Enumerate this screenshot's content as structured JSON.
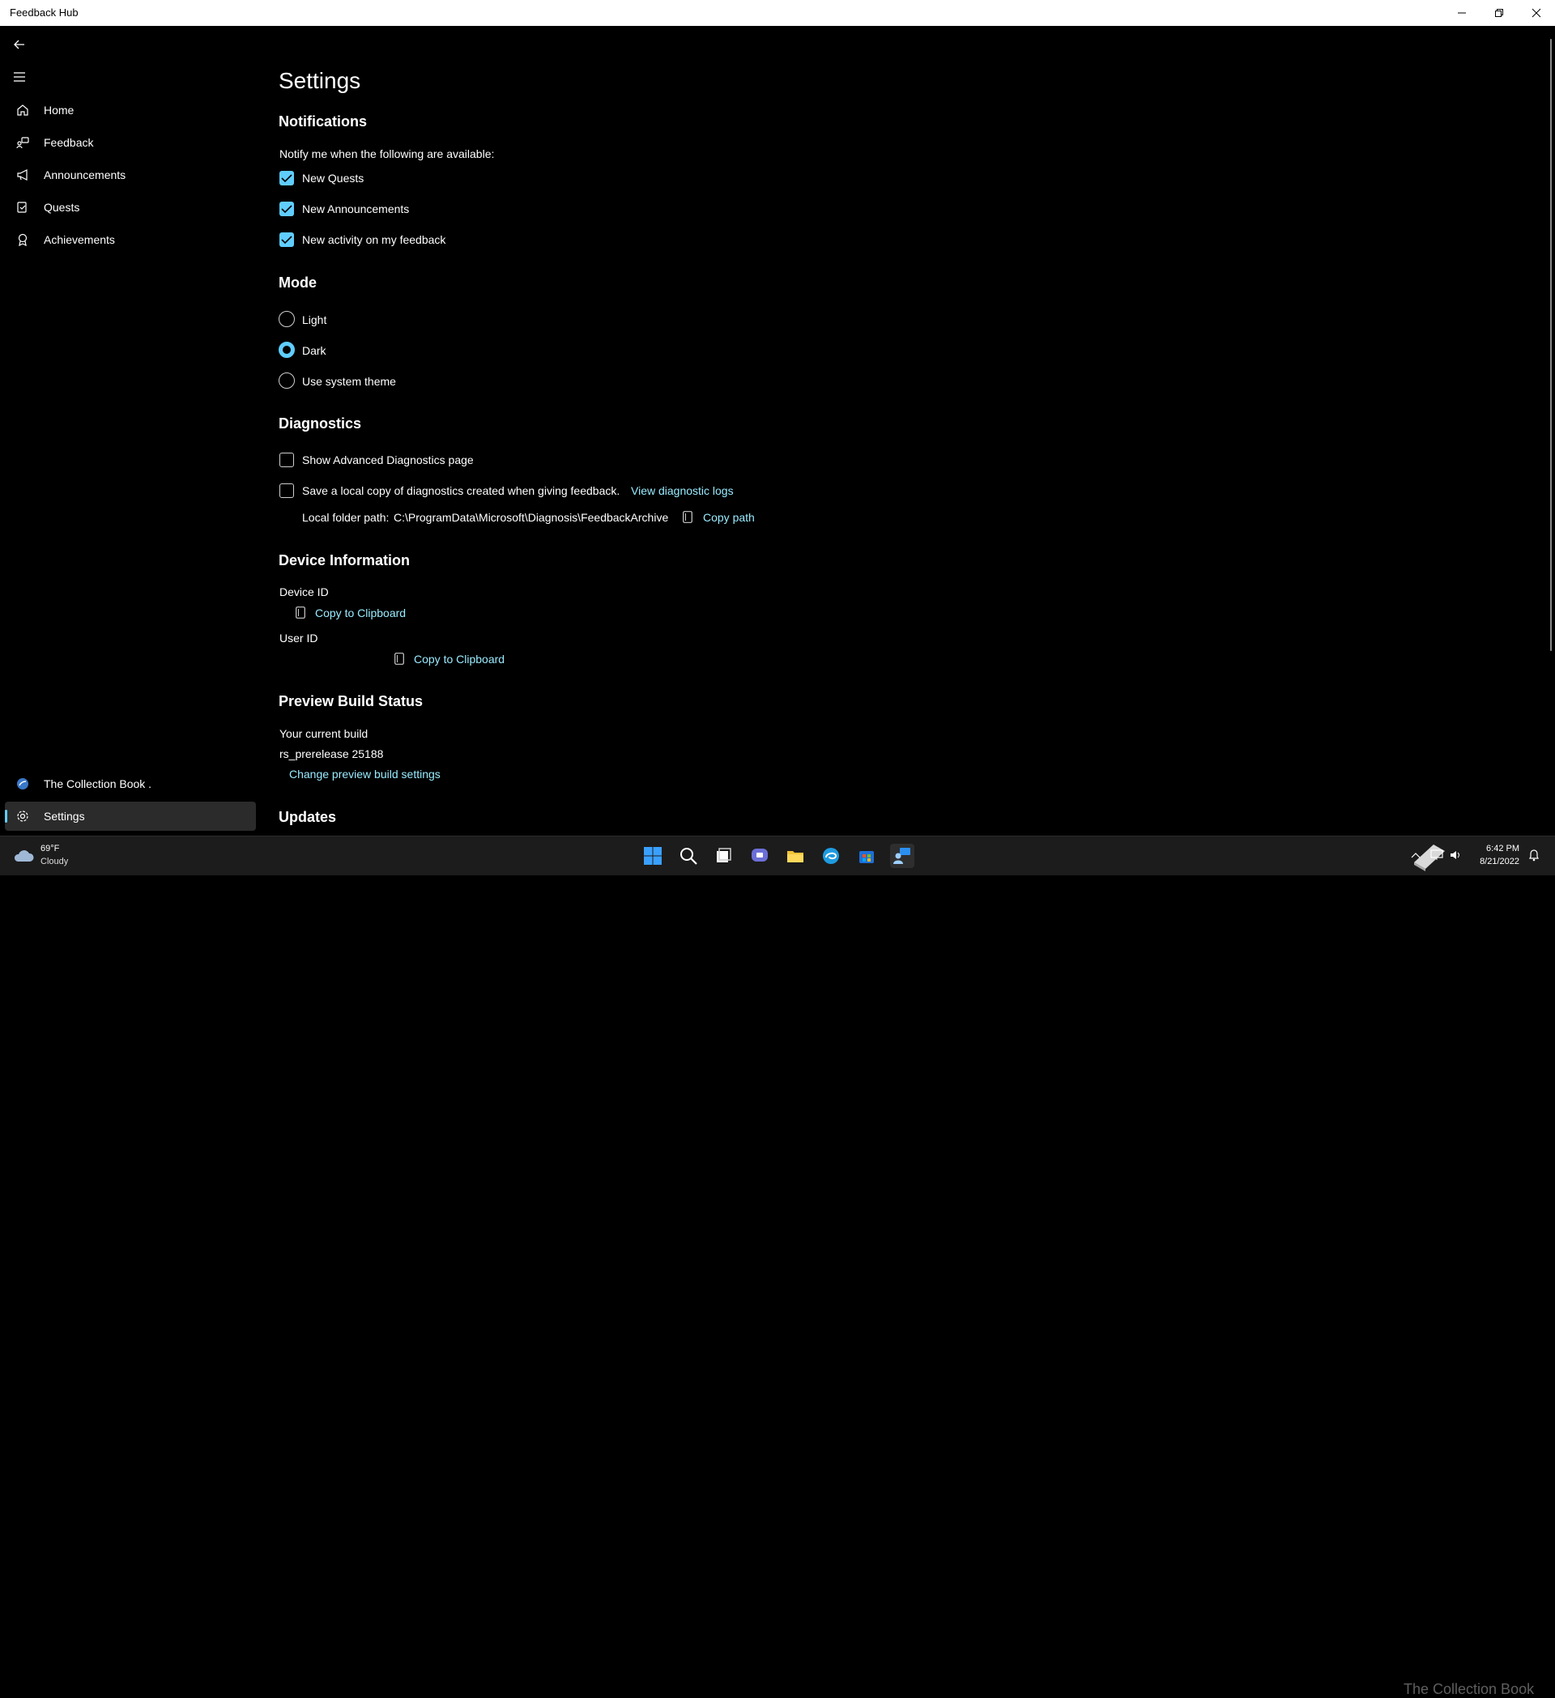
{
  "window": {
    "title": "Feedback Hub"
  },
  "sidebar": {
    "items": [
      {
        "label": "Home",
        "icon": "home-icon"
      },
      {
        "label": "Feedback",
        "icon": "feedback-icon"
      },
      {
        "label": "Announcements",
        "icon": "megaphone-icon"
      },
      {
        "label": "Quests",
        "icon": "quests-icon"
      },
      {
        "label": "Achievements",
        "icon": "medal-icon"
      }
    ],
    "account": "The Collection Book .",
    "settings": "Settings"
  },
  "page": {
    "title": "Settings"
  },
  "notifications": {
    "heading": "Notifications",
    "prompt": "Notify me when the following are available:",
    "options": [
      {
        "label": "New Quests",
        "checked": true
      },
      {
        "label": "New Announcements",
        "checked": true
      },
      {
        "label": "New activity on my feedback",
        "checked": true
      }
    ]
  },
  "mode": {
    "heading": "Mode",
    "options": [
      {
        "label": "Light",
        "selected": false
      },
      {
        "label": "Dark",
        "selected": true
      },
      {
        "label": "Use system theme",
        "selected": false
      }
    ]
  },
  "diagnostics": {
    "heading": "Diagnostics",
    "show_advanced": "Show Advanced Diagnostics page",
    "save_local": "Save a local copy of diagnostics created when giving feedback.",
    "view_logs": "View diagnostic logs",
    "folder_label": "Local folder path:",
    "folder_path": "C:\\ProgramData\\Microsoft\\Diagnosis\\FeedbackArchive",
    "copy_path": "Copy path"
  },
  "device_info": {
    "heading": "Device Information",
    "device_id_label": "Device ID",
    "device_copy": "Copy to Clipboard",
    "user_id_label": "User ID",
    "user_copy": "Copy to Clipboard"
  },
  "preview_build": {
    "heading": "Preview Build Status",
    "current_label": "Your current build",
    "build": "rs_prerelease 25188",
    "change_link": "Change preview build settings"
  },
  "updates": {
    "heading": "Updates"
  },
  "taskbar": {
    "weather_temp": "69°F",
    "weather_cond": "Cloudy",
    "time": "6:42 PM",
    "date": "8/21/2022",
    "watermark": "The Collection Book"
  },
  "colors": {
    "accent": "#60cdff",
    "link": "#99ebff",
    "background": "#000000"
  }
}
